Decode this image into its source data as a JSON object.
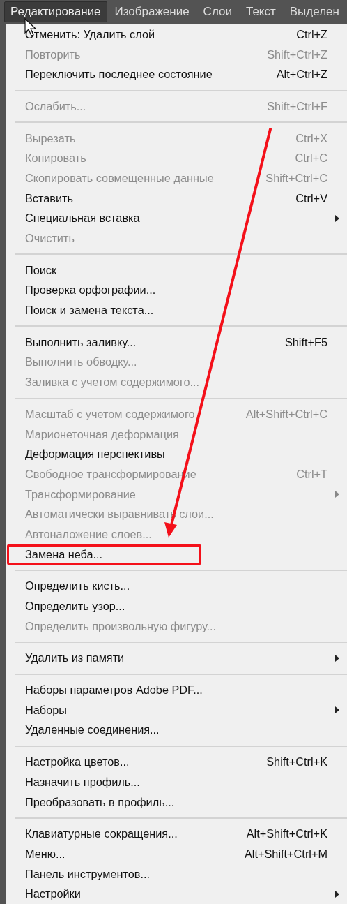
{
  "menubar": [
    {
      "label": "Редактирование",
      "selected": true
    },
    {
      "label": "Изображение",
      "selected": false
    },
    {
      "label": "Слои",
      "selected": false
    },
    {
      "label": "Текст",
      "selected": false
    },
    {
      "label": "Выделен",
      "selected": false
    }
  ],
  "menu": {
    "groups": [
      [
        {
          "label": "Отменить: Удалить слой",
          "shortcut": "Ctrl+Z",
          "disabled": false,
          "submenu": false,
          "annotated": false
        },
        {
          "label": "Повторить",
          "shortcut": "Shift+Ctrl+Z",
          "disabled": true,
          "submenu": false,
          "annotated": false
        },
        {
          "label": "Переключить последнее состояние",
          "shortcut": "Alt+Ctrl+Z",
          "disabled": false,
          "submenu": false,
          "annotated": false
        }
      ],
      [
        {
          "label": "Ослабить...",
          "shortcut": "Shift+Ctrl+F",
          "disabled": true,
          "submenu": false,
          "annotated": false
        }
      ],
      [
        {
          "label": "Вырезать",
          "shortcut": "Ctrl+X",
          "disabled": true,
          "submenu": false,
          "annotated": false
        },
        {
          "label": "Копировать",
          "shortcut": "Ctrl+C",
          "disabled": true,
          "submenu": false,
          "annotated": false
        },
        {
          "label": "Скопировать совмещенные данные",
          "shortcut": "Shift+Ctrl+C",
          "disabled": true,
          "submenu": false,
          "annotated": false
        },
        {
          "label": "Вставить",
          "shortcut": "Ctrl+V",
          "disabled": false,
          "submenu": false,
          "annotated": false
        },
        {
          "label": "Специальная вставка",
          "disabled": false,
          "submenu": true,
          "annotated": false
        },
        {
          "label": "Очистить",
          "disabled": true,
          "submenu": false,
          "annotated": false
        }
      ],
      [
        {
          "label": "Поиск",
          "disabled": false,
          "submenu": false,
          "annotated": false
        },
        {
          "label": "Проверка орфографии...",
          "disabled": false,
          "submenu": false,
          "annotated": false
        },
        {
          "label": "Поиск и замена текста...",
          "disabled": false,
          "submenu": false,
          "annotated": false
        }
      ],
      [
        {
          "label": "Выполнить заливку...",
          "shortcut": "Shift+F5",
          "disabled": false,
          "submenu": false,
          "annotated": false
        },
        {
          "label": "Выполнить обводку...",
          "disabled": true,
          "submenu": false,
          "annotated": false
        },
        {
          "label": "Заливка с учетом содержимого...",
          "disabled": true,
          "submenu": false,
          "annotated": false
        }
      ],
      [
        {
          "label": "Масштаб с учетом содержимого",
          "shortcut": "Alt+Shift+Ctrl+C",
          "disabled": true,
          "submenu": false,
          "annotated": false
        },
        {
          "label": "Марионеточная деформация",
          "disabled": true,
          "submenu": false,
          "annotated": false
        },
        {
          "label": "Деформация перспективы",
          "disabled": false,
          "submenu": false,
          "annotated": false
        },
        {
          "label": "Свободное трансформирование",
          "shortcut": "Ctrl+T",
          "disabled": true,
          "submenu": false,
          "annotated": false
        },
        {
          "label": "Трансформирование",
          "disabled": true,
          "submenu": true,
          "annotated": false
        },
        {
          "label": "Автоматически выравнивать слои...",
          "disabled": true,
          "submenu": false,
          "annotated": false
        },
        {
          "label": "Автоналожение слоев...",
          "disabled": true,
          "submenu": false,
          "annotated": false
        },
        {
          "label": "Замена неба...",
          "disabled": false,
          "submenu": false,
          "annotated": true
        }
      ],
      [
        {
          "label": "Определить кисть...",
          "disabled": false,
          "submenu": false,
          "annotated": false
        },
        {
          "label": "Определить узор...",
          "disabled": false,
          "submenu": false,
          "annotated": false
        },
        {
          "label": "Определить произвольную фигуру...",
          "disabled": true,
          "submenu": false,
          "annotated": false
        }
      ],
      [
        {
          "label": "Удалить из памяти",
          "disabled": false,
          "submenu": true,
          "annotated": false
        }
      ],
      [
        {
          "label": "Наборы параметров Adobe PDF...",
          "disabled": false,
          "submenu": false,
          "annotated": false
        },
        {
          "label": "Наборы",
          "disabled": false,
          "submenu": true,
          "annotated": false
        },
        {
          "label": "Удаленные соединения...",
          "disabled": false,
          "submenu": false,
          "annotated": false
        }
      ],
      [
        {
          "label": "Настройка цветов...",
          "shortcut": "Shift+Ctrl+K",
          "disabled": false,
          "submenu": false,
          "annotated": false
        },
        {
          "label": "Назначить профиль...",
          "disabled": false,
          "submenu": false,
          "annotated": false
        },
        {
          "label": "Преобразовать в профиль...",
          "disabled": false,
          "submenu": false,
          "annotated": false
        }
      ],
      [
        {
          "label": "Клавиатурные сокращения...",
          "shortcut": "Alt+Shift+Ctrl+K",
          "disabled": false,
          "submenu": false,
          "annotated": false
        },
        {
          "label": "Меню...",
          "shortcut": "Alt+Shift+Ctrl+M",
          "disabled": false,
          "submenu": false,
          "annotated": false
        },
        {
          "label": "Панель инструментов...",
          "disabled": false,
          "submenu": false,
          "annotated": false
        },
        {
          "label": "Настройки",
          "disabled": false,
          "submenu": true,
          "annotated": false
        }
      ]
    ]
  }
}
